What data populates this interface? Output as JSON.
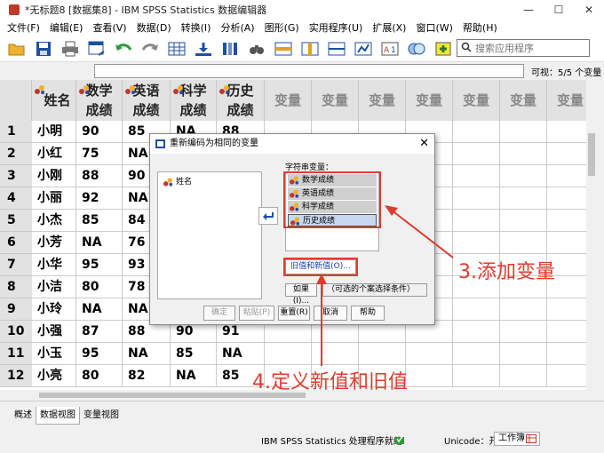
{
  "window": {
    "title": "*无标题8 [数据集8] - IBM SPSS Statistics 数据编辑器",
    "controls": [
      "—",
      "☐",
      "✕"
    ]
  },
  "menu": [
    "文件(F)",
    "编辑(E)",
    "查看(V)",
    "数据(D)",
    "转换(I)",
    "分析(A)",
    "图形(G)",
    "实用程序(U)",
    "扩展(X)",
    "窗口(W)",
    "帮助(H)"
  ],
  "search": {
    "placeholder": "搜索应用程序"
  },
  "visible_count": "可视：5/5 个变量",
  "grid": {
    "headers": [
      {
        "line1": "姓名",
        "line2": ""
      },
      {
        "line1": "数学",
        "line2": "成绩"
      },
      {
        "line1": "英语",
        "line2": "成绩"
      },
      {
        "line1": "科学",
        "line2": "成绩"
      },
      {
        "line1": "历史",
        "line2": "成绩"
      }
    ],
    "empty_header": "变量",
    "rows": [
      [
        "1",
        "小明",
        "90",
        "85",
        "NA",
        "88"
      ],
      [
        "2",
        "小红",
        "75",
        "NA",
        "",
        ""
      ],
      [
        "3",
        "小刚",
        "88",
        "90",
        "",
        ""
      ],
      [
        "4",
        "小丽",
        "92",
        "NA",
        "",
        ""
      ],
      [
        "5",
        "小杰",
        "85",
        "84",
        "",
        ""
      ],
      [
        "6",
        "小芳",
        "NA",
        "76",
        "",
        ""
      ],
      [
        "7",
        "小华",
        "95",
        "93",
        "",
        ""
      ],
      [
        "8",
        "小洁",
        "80",
        "78",
        "",
        ""
      ],
      [
        "9",
        "小玲",
        "NA",
        "NA",
        "",
        ""
      ],
      [
        "10",
        "小强",
        "87",
        "88",
        "90",
        "91"
      ],
      [
        "11",
        "小玉",
        "95",
        "NA",
        "85",
        "NA"
      ],
      [
        "12",
        "小亮",
        "80",
        "82",
        "NA",
        "85"
      ]
    ]
  },
  "tabs": [
    "概述",
    "数据视图",
    "变量视图"
  ],
  "status": {
    "processor": "IBM SPSS Statistics 处理程序就绪",
    "unicode": "Unicode：开",
    "mode": "工作簿"
  },
  "dialog": {
    "title": "重新编码为相同的变量",
    "source_items": [
      "姓名"
    ],
    "target_label": "字符串变量：",
    "target_items": [
      "数学成绩",
      "英语成绩",
      "科学成绩",
      "历史成绩"
    ],
    "old_new_button": "旧值和新值(O)...",
    "if_button": "如果(I)...",
    "if_note": "（可选的个案选择条件）",
    "buttons": [
      "确定",
      "粘贴(P)",
      "重置(R)",
      "取消",
      "帮助"
    ]
  },
  "annotations": {
    "step3": "3.添加变量",
    "step4": "4.定义新值和旧值"
  },
  "colors": {
    "annotation": "#e23b2e",
    "accent_blue": "#1a3fb3"
  }
}
